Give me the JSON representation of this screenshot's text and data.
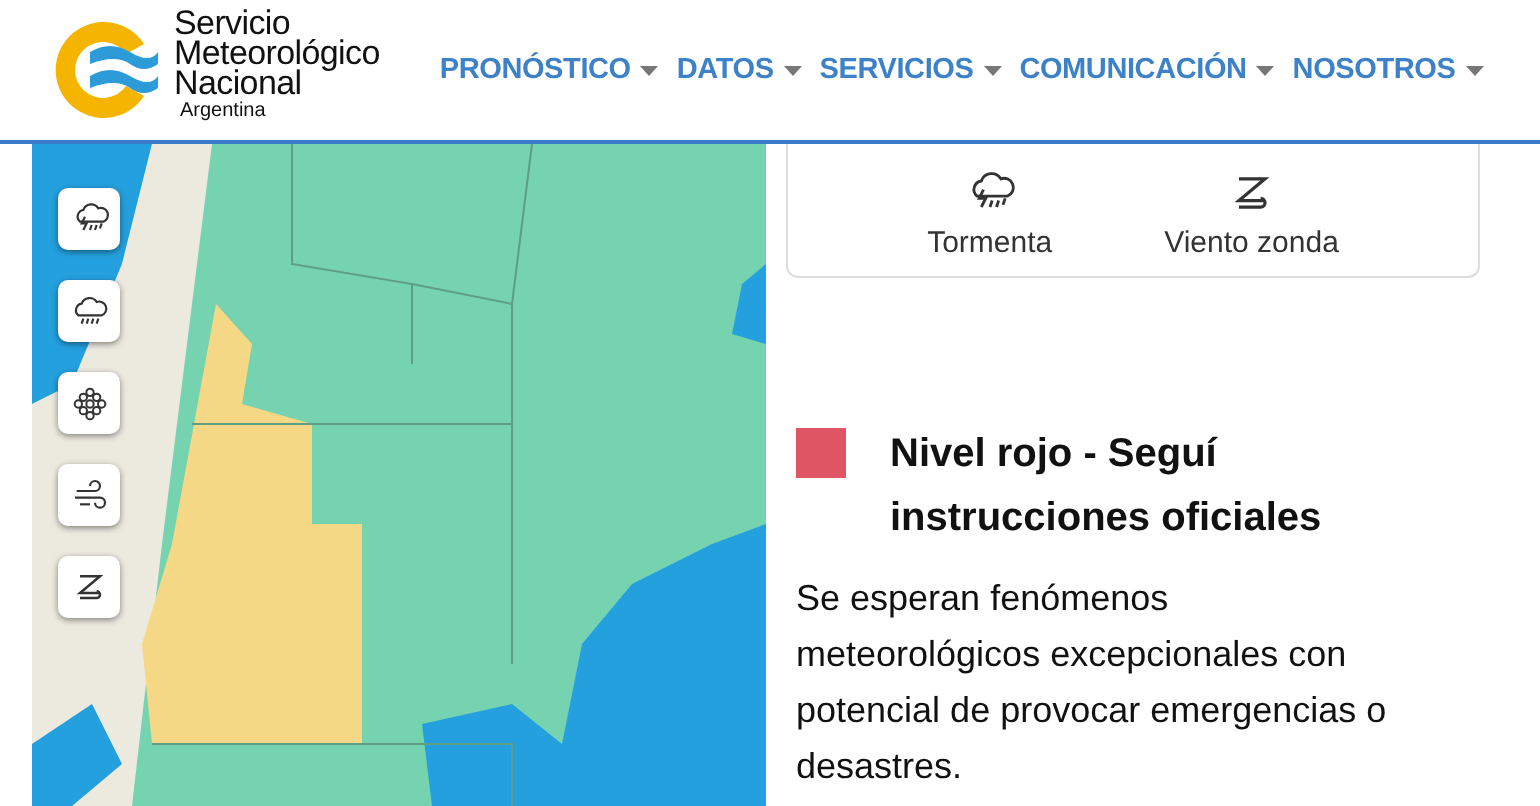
{
  "header": {
    "logo": {
      "name_lines": [
        "Servicio",
        "Meteorológico",
        "Nacional"
      ],
      "country": "Argentina"
    },
    "nav": [
      {
        "label": "PRONÓSTICO",
        "has_menu": true
      },
      {
        "label": "DATOS",
        "has_menu": true
      },
      {
        "label": "SERVICIOS",
        "has_menu": true
      },
      {
        "label": "COMUNICACIÓN",
        "has_menu": true
      },
      {
        "label": "NOSOTROS",
        "has_menu": true
      }
    ]
  },
  "map": {
    "kind": "picture",
    "layer_buttons": [
      {
        "kind": "storm"
      },
      {
        "kind": "rain"
      },
      {
        "kind": "snow"
      },
      {
        "kind": "wind"
      },
      {
        "kind": "zonda"
      }
    ]
  },
  "legend": [
    {
      "kind": "storm",
      "label": "Tormenta"
    },
    {
      "kind": "zonda",
      "label": "Viento zonda"
    }
  ],
  "alert": {
    "color": "#e05563",
    "title": "Nivel rojo - Seguí instrucciones oficiales",
    "description": "Se esperan fenómenos meteorológicos excepcionales con potencial de provocar emergencias o desastres."
  }
}
